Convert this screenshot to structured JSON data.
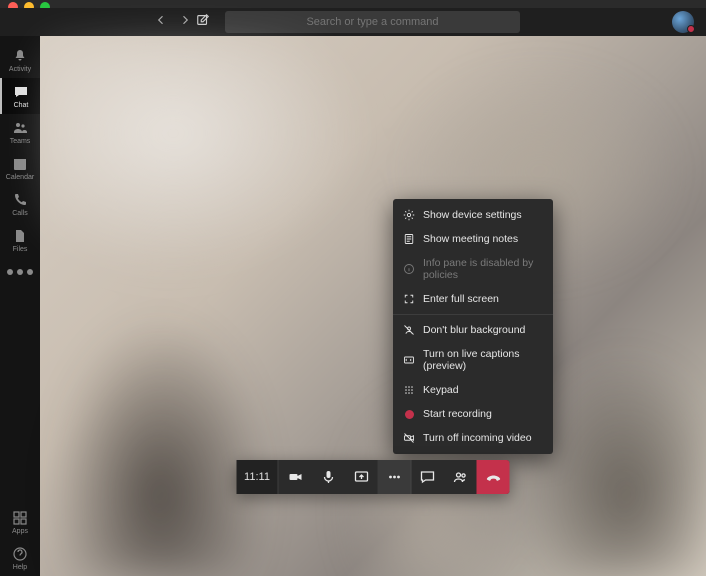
{
  "search": {
    "placeholder": "Search or type a command"
  },
  "rail": {
    "items": [
      {
        "label": "Activity"
      },
      {
        "label": "Chat"
      },
      {
        "label": "Teams"
      },
      {
        "label": "Calendar"
      },
      {
        "label": "Calls"
      },
      {
        "label": "Files"
      }
    ],
    "apps_label": "Apps",
    "help_label": "Help"
  },
  "call": {
    "duration": "11:11"
  },
  "menu": {
    "show_device_settings": "Show device settings",
    "show_meeting_notes": "Show meeting notes",
    "info_pane_disabled": "Info pane is disabled by policies",
    "enter_full_screen": "Enter full screen",
    "dont_blur_background": "Don't blur background",
    "turn_on_live_captions": "Turn on live captions (preview)",
    "keypad": "Keypad",
    "start_recording": "Start recording",
    "turn_off_incoming_video": "Turn off incoming video"
  },
  "colors": {
    "hangup": "#c4314b"
  }
}
